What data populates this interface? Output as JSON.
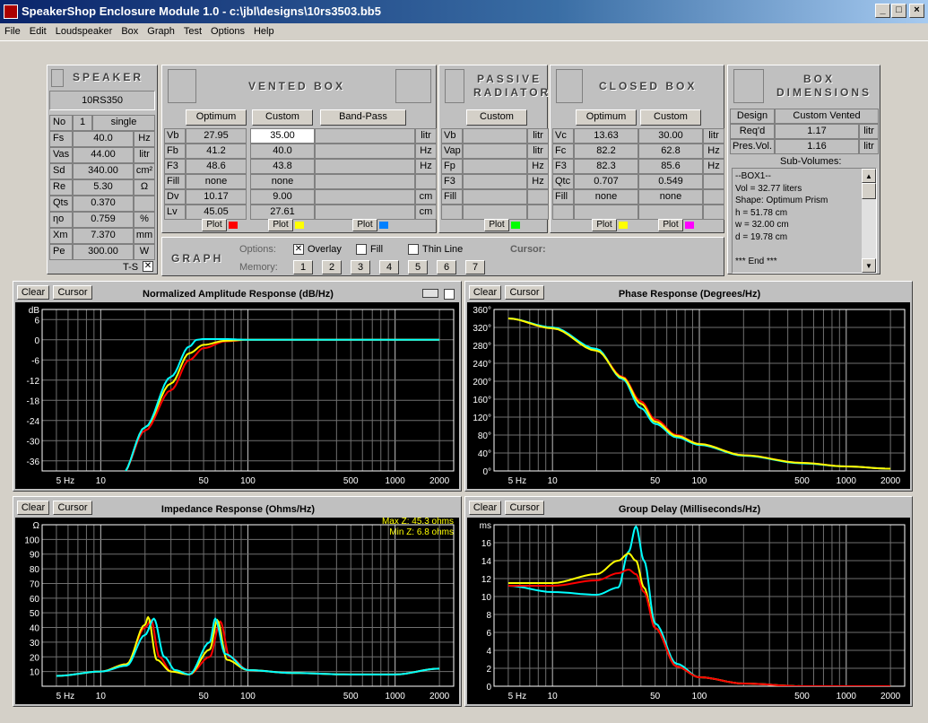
{
  "window": {
    "title": "SpeakerShop Enclosure Module 1.0 - c:\\jbl\\designs\\10rs3503.bb5"
  },
  "menu": [
    "File",
    "Edit",
    "Loudspeaker",
    "Box",
    "Graph",
    "Test",
    "Options",
    "Help"
  ],
  "speaker": {
    "header": "SPEAKER",
    "model": "10RS350",
    "rows": [
      {
        "label": "No",
        "value": "1",
        "unit": "single"
      },
      {
        "label": "Fs",
        "value": "40.0",
        "unit": "Hz"
      },
      {
        "label": "Vas",
        "value": "44.00",
        "unit": "litr"
      },
      {
        "label": "Sd",
        "value": "340.00",
        "unit": "cm²"
      },
      {
        "label": "Re",
        "value": "5.30",
        "unit": "Ω"
      },
      {
        "label": "Qts",
        "value": "0.370",
        "unit": ""
      },
      {
        "label": "ηo",
        "value": "0.759",
        "unit": "%"
      },
      {
        "label": "Xm",
        "value": "7.370",
        "unit": "mm"
      },
      {
        "label": "Pe",
        "value": "300.00",
        "unit": "W"
      }
    ],
    "ts_label": "T-S"
  },
  "vented": {
    "header": "VENTED BOX",
    "btn_opt": "Optimum",
    "btn_custom": "Custom",
    "btn_bp": "Band-Pass",
    "rows": [
      {
        "label": "Vb",
        "opt": "27.95",
        "custom": "35.00",
        "unit": "litr"
      },
      {
        "label": "Fb",
        "opt": "41.2",
        "custom": "40.0",
        "unit": "Hz"
      },
      {
        "label": "F3",
        "opt": "48.6",
        "custom": "43.8",
        "unit": "Hz"
      },
      {
        "label": "Fill",
        "opt": "none",
        "custom": "none",
        "unit": ""
      },
      {
        "label": "Dv",
        "opt": "10.17",
        "custom": "9.00",
        "unit": "cm"
      },
      {
        "label": "Lv",
        "opt": "45.05",
        "custom": "27.61",
        "unit": "cm"
      }
    ],
    "plot": "Plot"
  },
  "passive": {
    "header1": "PASSIVE",
    "header2": "RADIATOR",
    "btn_custom": "Custom",
    "rows": [
      {
        "label": "Vb",
        "unit": "litr"
      },
      {
        "label": "Vap",
        "unit": "litr"
      },
      {
        "label": "Fp",
        "unit": "Hz"
      },
      {
        "label": "F3",
        "unit": "Hz"
      },
      {
        "label": "Fill",
        "unit": ""
      }
    ],
    "plot": "Plot"
  },
  "closed": {
    "header": "CLOSED BOX",
    "btn_opt": "Optimum",
    "btn_custom": "Custom",
    "rows": [
      {
        "label": "Vc",
        "opt": "13.63",
        "custom": "30.00",
        "unit": "litr"
      },
      {
        "label": "Fc",
        "opt": "82.2",
        "custom": "62.8",
        "unit": "Hz"
      },
      {
        "label": "F3",
        "opt": "82.3",
        "custom": "85.6",
        "unit": "Hz"
      },
      {
        "label": "Qtc",
        "opt": "0.707",
        "custom": "0.549",
        "unit": ""
      },
      {
        "label": "Fill",
        "opt": "none",
        "custom": "none",
        "unit": ""
      }
    ],
    "plot": "Plot"
  },
  "box_dims": {
    "header1": "BOX",
    "header2": "DIMENSIONS",
    "design_label": "Design",
    "design_value": "Custom Vented",
    "reqd_label": "Req'd Vol.",
    "reqd_value": "1.17",
    "pres_label": "Pres.Vol.",
    "pres_value": "1.16",
    "unit": "litr",
    "sub_label": "Sub-Volumes:",
    "sub_lines": [
      "--BOX1--",
      "Vol = 32.77 liters",
      "Shape: Optimum Prism",
      "h = 51.78 cm",
      "w = 32.00 cm",
      "d = 19.78 cm",
      "",
      "*** End ***"
    ]
  },
  "graph_ctrl": {
    "header": "GRAPH",
    "options_label": "Options:",
    "overlay": "Overlay",
    "fill": "Fill",
    "thin": "Thin Line",
    "memory_label": "Memory:",
    "memory": [
      "1",
      "2",
      "3",
      "4",
      "5",
      "6",
      "7"
    ],
    "cursor_label": "Cursor:"
  },
  "colors": {
    "red": "#ff0000",
    "yellow": "#ffff00",
    "cyan": "#00ffff",
    "green": "#00ff00",
    "blue": "#0080ff",
    "magenta": "#ff00ff"
  },
  "graphs": {
    "clear": "Clear",
    "cursor": "Cursor",
    "amp": {
      "title": "Normalized Amplitude Response (dB/Hz)",
      "unit": "dB",
      "yticks": [
        "6",
        "0",
        "-6",
        "-12",
        "-18",
        "-24",
        "-30",
        "-36"
      ]
    },
    "phase": {
      "title": "Phase Response (Degrees/Hz)",
      "yticks": [
        "360°",
        "320°",
        "280°",
        "240°",
        "200°",
        "160°",
        "120°",
        "80°",
        "40°",
        "0°"
      ]
    },
    "imp": {
      "title": "Impedance Response (Ohms/Hz)",
      "unit": "Ω",
      "yticks": [
        "100",
        "90",
        "80",
        "70",
        "60",
        "50",
        "40",
        "30",
        "20",
        "10"
      ],
      "maxz": "Max Z: 45.3 ohms",
      "minz": "Min Z: 6.8 ohms"
    },
    "gd": {
      "title": "Group Delay (Milliseconds/Hz)",
      "unit": "ms",
      "yticks": [
        "16",
        "14",
        "12",
        "10",
        "8",
        "6",
        "4",
        "2",
        "0"
      ]
    },
    "xticks": [
      "5 Hz",
      "10",
      "50",
      "100",
      "500",
      "1000",
      "2000"
    ]
  },
  "chart_data": [
    {
      "type": "line",
      "title": "Normalized Amplitude Response (dB/Hz)",
      "ylabel": "dB",
      "xscale": "log",
      "xlim": [
        4,
        2500
      ],
      "ylim": [
        -39,
        9
      ],
      "series": [
        {
          "color": "#ff0000",
          "points": [
            [
              14,
              -40
            ],
            [
              20,
              -27
            ],
            [
              30,
              -15
            ],
            [
              40,
              -6
            ],
            [
              50,
              -2.5
            ],
            [
              70,
              -0.5
            ],
            [
              100,
              0
            ],
            [
              2000,
              0
            ]
          ]
        },
        {
          "color": "#ffff00",
          "points": [
            [
              14,
              -40
            ],
            [
              20,
              -26
            ],
            [
              30,
              -13
            ],
            [
              40,
              -4
            ],
            [
              50,
              -1.5
            ],
            [
              70,
              -0.3
            ],
            [
              100,
              0
            ],
            [
              2000,
              0
            ]
          ]
        },
        {
          "color": "#00ffff",
          "points": [
            [
              14,
              -40
            ],
            [
              20,
              -26
            ],
            [
              30,
              -11
            ],
            [
              40,
              -2
            ],
            [
              45,
              0
            ],
            [
              50,
              0.2
            ],
            [
              70,
              0.2
            ],
            [
              100,
              0
            ],
            [
              2000,
              0
            ]
          ]
        }
      ]
    },
    {
      "type": "line",
      "title": "Phase Response (Degrees/Hz)",
      "xscale": "log",
      "xlim": [
        4,
        2500
      ],
      "ylim": [
        0,
        360
      ],
      "series": [
        {
          "color": "#ff0000",
          "points": [
            [
              5,
              340
            ],
            [
              10,
              318
            ],
            [
              20,
              270
            ],
            [
              30,
              210
            ],
            [
              40,
              155
            ],
            [
              50,
              115
            ],
            [
              70,
              80
            ],
            [
              100,
              60
            ],
            [
              200,
              35
            ],
            [
              500,
              18
            ],
            [
              1000,
              10
            ],
            [
              2000,
              5
            ]
          ]
        },
        {
          "color": "#00ffff",
          "points": [
            [
              5,
              340
            ],
            [
              10,
              320
            ],
            [
              20,
              272
            ],
            [
              30,
              205
            ],
            [
              40,
              140
            ],
            [
              50,
              105
            ],
            [
              70,
              75
            ],
            [
              100,
              58
            ],
            [
              200,
              34
            ],
            [
              500,
              17
            ],
            [
              1000,
              10
            ],
            [
              2000,
              5
            ]
          ]
        },
        {
          "color": "#ffff00",
          "points": [
            [
              5,
              340
            ],
            [
              10,
              318
            ],
            [
              20,
              268
            ],
            [
              30,
              208
            ],
            [
              40,
              150
            ],
            [
              50,
              110
            ],
            [
              70,
              78
            ],
            [
              100,
              60
            ],
            [
              200,
              35
            ],
            [
              500,
              18
            ],
            [
              1000,
              10
            ],
            [
              2000,
              5
            ]
          ]
        }
      ]
    },
    {
      "type": "line",
      "title": "Impedance Response (Ohms/Hz)",
      "ylabel": "Ω",
      "xscale": "log",
      "xlim": [
        4,
        2500
      ],
      "ylim": [
        0,
        110
      ],
      "series": [
        {
          "color": "#ff0000",
          "points": [
            [
              5,
              7
            ],
            [
              10,
              10
            ],
            [
              15,
              15
            ],
            [
              20,
              40
            ],
            [
              22,
              45
            ],
            [
              25,
              20
            ],
            [
              30,
              10
            ],
            [
              40,
              8
            ],
            [
              55,
              20
            ],
            [
              65,
              44
            ],
            [
              75,
              20
            ],
            [
              100,
              11
            ],
            [
              200,
              9
            ],
            [
              500,
              8
            ],
            [
              1000,
              8
            ],
            [
              2000,
              12
            ]
          ]
        },
        {
          "color": "#ffff00",
          "points": [
            [
              5,
              7
            ],
            [
              10,
              10
            ],
            [
              15,
              15
            ],
            [
              20,
              42
            ],
            [
              21,
              47
            ],
            [
              24,
              18
            ],
            [
              30,
              10
            ],
            [
              40,
              8
            ],
            [
              55,
              25
            ],
            [
              62,
              45
            ],
            [
              72,
              18
            ],
            [
              100,
              11
            ],
            [
              200,
              9
            ],
            [
              500,
              8
            ],
            [
              1000,
              8
            ],
            [
              2000,
              12
            ]
          ]
        },
        {
          "color": "#00ffff",
          "points": [
            [
              5,
              7
            ],
            [
              10,
              10
            ],
            [
              15,
              14
            ],
            [
              20,
              35
            ],
            [
              23,
              46
            ],
            [
              27,
              20
            ],
            [
              32,
              11
            ],
            [
              40,
              8
            ],
            [
              55,
              30
            ],
            [
              60,
              46
            ],
            [
              70,
              22
            ],
            [
              100,
              11
            ],
            [
              200,
              9
            ],
            [
              500,
              8
            ],
            [
              1000,
              8
            ],
            [
              2000,
              12
            ]
          ]
        }
      ]
    },
    {
      "type": "line",
      "title": "Group Delay (Milliseconds/Hz)",
      "ylabel": "ms",
      "xscale": "log",
      "xlim": [
        4,
        2500
      ],
      "ylim": [
        0,
        18
      ],
      "series": [
        {
          "color": "#00ffff",
          "points": [
            [
              5,
              11.2
            ],
            [
              10,
              10.5
            ],
            [
              20,
              10.2
            ],
            [
              28,
              11
            ],
            [
              33,
              15
            ],
            [
              37,
              17.8
            ],
            [
              42,
              14
            ],
            [
              50,
              7
            ],
            [
              70,
              2.5
            ],
            [
              100,
              1
            ],
            [
              200,
              0.3
            ],
            [
              500,
              0
            ],
            [
              2000,
              0
            ]
          ]
        },
        {
          "color": "#ffff00",
          "points": [
            [
              5,
              11.5
            ],
            [
              10,
              11.5
            ],
            [
              20,
              12.5
            ],
            [
              28,
              14
            ],
            [
              33,
              14.8
            ],
            [
              37,
              14
            ],
            [
              42,
              11
            ],
            [
              50,
              6.5
            ],
            [
              70,
              2.2
            ],
            [
              100,
              1
            ],
            [
              200,
              0.3
            ],
            [
              500,
              0
            ],
            [
              2000,
              0
            ]
          ]
        },
        {
          "color": "#ff0000",
          "points": [
            [
              5,
              11.2
            ],
            [
              10,
              11.2
            ],
            [
              20,
              11.8
            ],
            [
              28,
              12.6
            ],
            [
              33,
              13
            ],
            [
              37,
              12.5
            ],
            [
              42,
              10.5
            ],
            [
              50,
              6.5
            ],
            [
              70,
              2.2
            ],
            [
              100,
              1
            ],
            [
              200,
              0.3
            ],
            [
              500,
              0
            ],
            [
              2000,
              0
            ]
          ]
        }
      ]
    }
  ]
}
